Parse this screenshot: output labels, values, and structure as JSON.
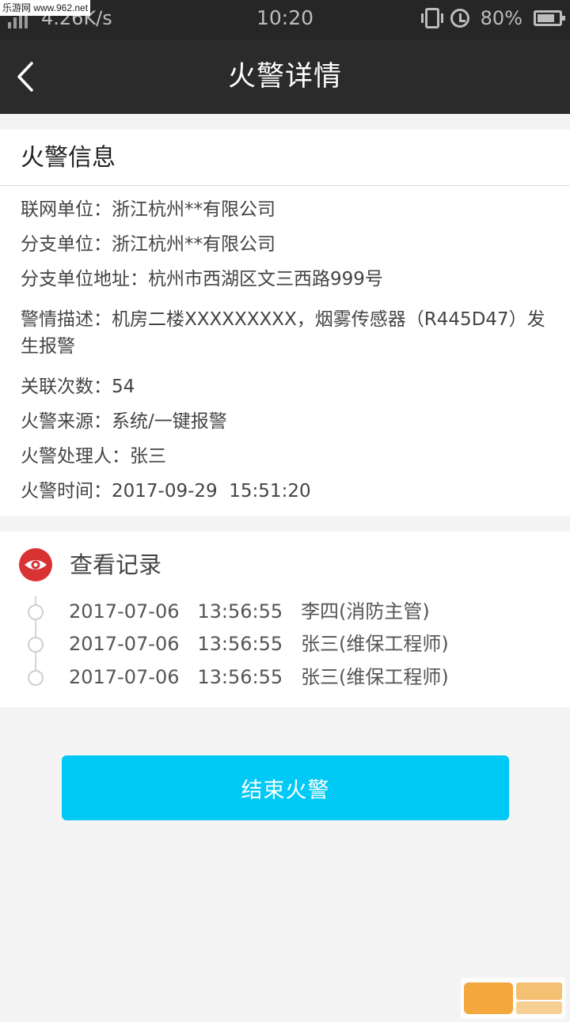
{
  "status_bar": {
    "network_speed": "4.26K/s",
    "time": "10:20",
    "battery": "80%",
    "battery_level": 0.8,
    "watermark": "乐游网 www.962.net"
  },
  "header": {
    "title": "火警详情"
  },
  "fire_info": {
    "section_title": "火警信息",
    "rows": [
      {
        "label": "联网单位：",
        "value": "浙江杭州**有限公司"
      },
      {
        "label": "分支单位：",
        "value": "浙江杭州**有限公司"
      },
      {
        "label": "分支单位地址：",
        "value": "杭州市西湖区文三西路999号"
      },
      {
        "label": "警情描述：",
        "value": "机房二楼XXXXXXXXX，烟雾传感器（R445D47）发生报警"
      },
      {
        "label": "关联次数：",
        "value": "54"
      },
      {
        "label": "火警来源：",
        "value": "系统/一键报警"
      },
      {
        "label": "火警处理人：",
        "value": "张三"
      },
      {
        "label": "火警时间：",
        "value": "2017-09-29  15:51:20"
      }
    ]
  },
  "view_records": {
    "section_title": "查看记录",
    "items": [
      {
        "date": "2017-07-06",
        "time": "13:56:55",
        "person": "李四(消防主管)"
      },
      {
        "date": "2017-07-06",
        "time": "13:56:55",
        "person": "张三(维保工程师)"
      },
      {
        "date": "2017-07-06",
        "time": "13:56:55",
        "person": "张三(维保工程师)"
      }
    ]
  },
  "actions": {
    "end_fire_label": "结束火警"
  },
  "colors": {
    "header_bg": "#2b2b2b",
    "accent_button": "#00c9f5",
    "eye_badge": "#d83232"
  }
}
